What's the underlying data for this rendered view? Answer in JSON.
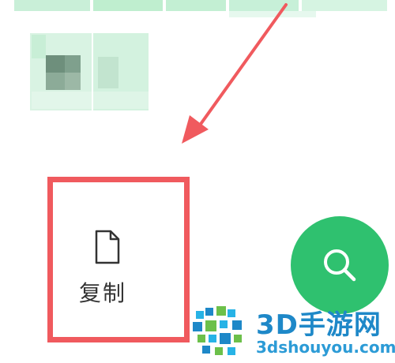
{
  "context_menu": {
    "copy_label": "复制",
    "copy_icon": "document-icon"
  },
  "search_button": {
    "icon": "search-icon",
    "color": "#2fc16f"
  },
  "annotation": {
    "highlight_color": "#f05a5e",
    "arrow_color": "#f05a5e"
  },
  "watermark": {
    "title": "3D手游网",
    "url": "3dshouyou.com"
  }
}
